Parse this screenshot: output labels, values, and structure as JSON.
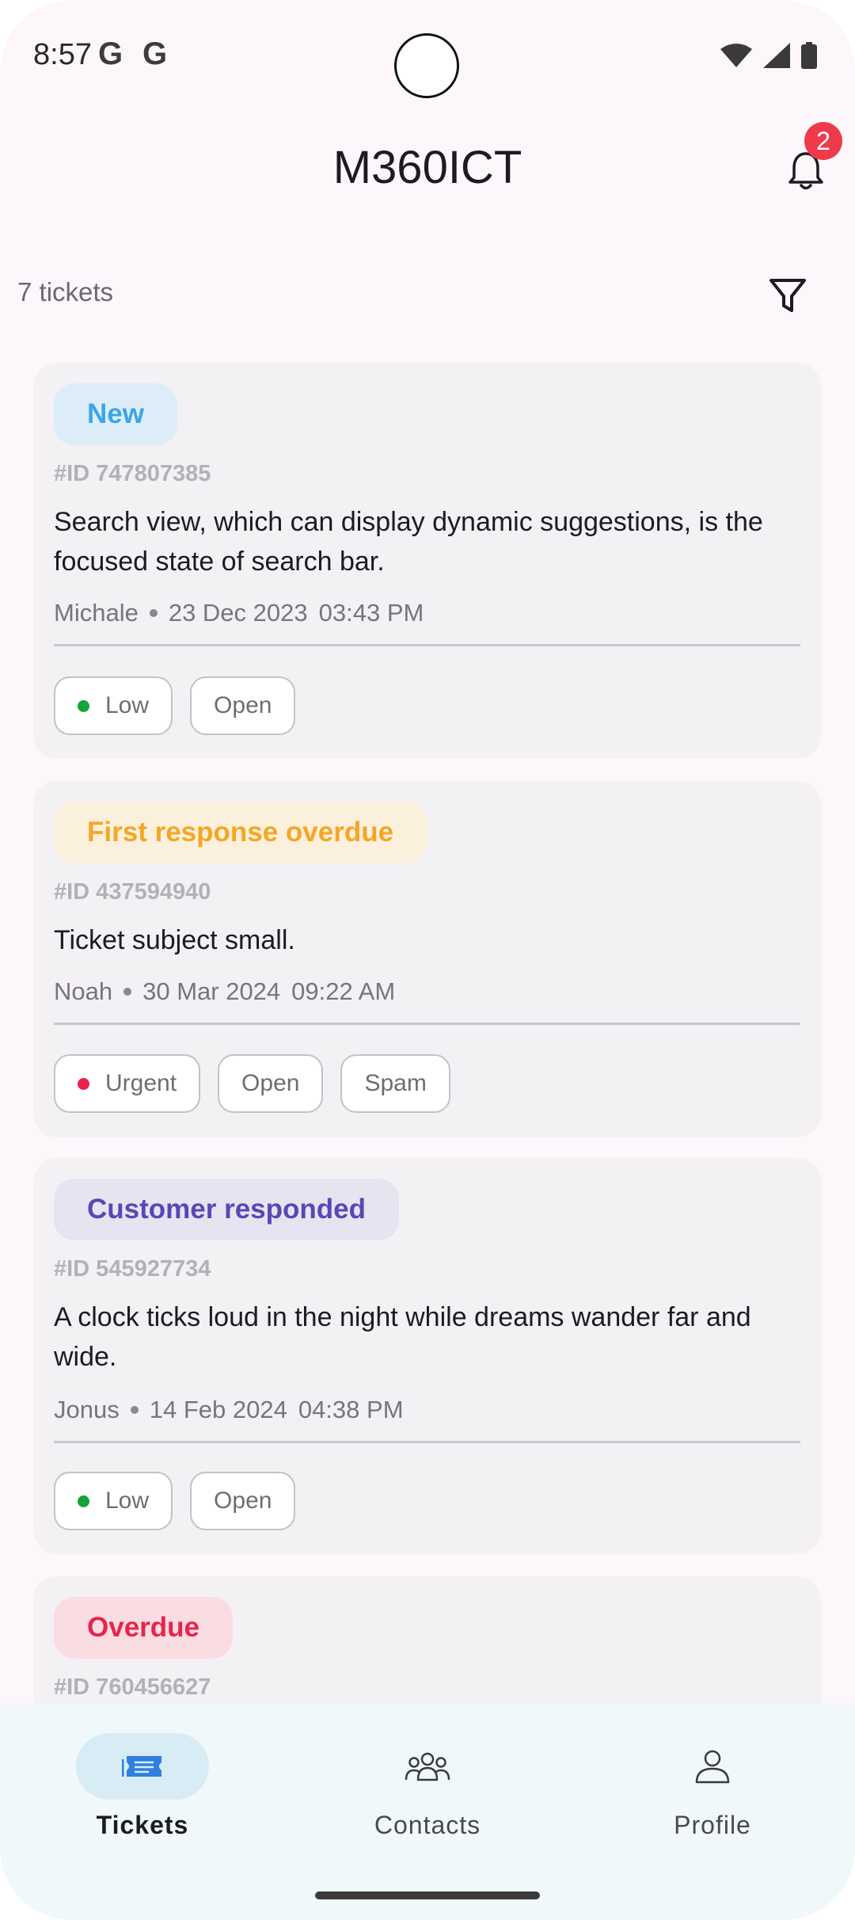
{
  "status": {
    "time": "8:57",
    "google_icons": [
      "G",
      "G"
    ]
  },
  "app": {
    "title": "M360ICT",
    "notification_count": "2"
  },
  "list": {
    "count_label": "7 tickets"
  },
  "tickets": [
    {
      "status": "New",
      "status_color": "#3aa6e6",
      "status_bg": "#dcedf8",
      "id": "#ID 747807385",
      "subject": "Search view, which can display dynamic suggestions, is the focused state of search bar.",
      "author": "Michale",
      "date": "23 Dec 2023",
      "time": "03:43 PM",
      "chips": [
        {
          "label": "Low",
          "dot": "#13a538"
        },
        {
          "label": "Open"
        }
      ]
    },
    {
      "status": "First response overdue",
      "status_color": "#f5a623",
      "status_bg": "#fbf0dc",
      "id": "#ID 437594940",
      "subject": "Ticket subject small.",
      "author": "Noah",
      "date": "30 Mar 2024",
      "time": "09:22 AM",
      "chips": [
        {
          "label": "Urgent",
          "dot": "#e8244c"
        },
        {
          "label": "Open"
        },
        {
          "label": "Spam"
        }
      ]
    },
    {
      "status": "Customer responded",
      "status_color": "#5a46b5",
      "status_bg": "#e6e4f0",
      "id": "#ID 545927734",
      "subject": "A clock ticks loud in the night while dreams wander far and wide.",
      "author": "Jonus",
      "date": "14 Feb 2024",
      "time": "04:38 PM",
      "chips": [
        {
          "label": "Low",
          "dot": "#13a538"
        },
        {
          "label": "Open"
        }
      ]
    },
    {
      "status": "Overdue",
      "status_color": "#e8244c",
      "status_bg": "#fadde2",
      "id": "#ID 760456627"
    }
  ],
  "nav": {
    "items": [
      {
        "label": "Tickets",
        "icon": "ticket-icon",
        "active": true
      },
      {
        "label": "Contacts",
        "icon": "contacts-icon",
        "active": false
      },
      {
        "label": "Profile",
        "icon": "profile-icon",
        "active": false
      }
    ],
    "active_pill_color": "#d8ecf6",
    "active_icon_color": "#2f7fe0"
  }
}
